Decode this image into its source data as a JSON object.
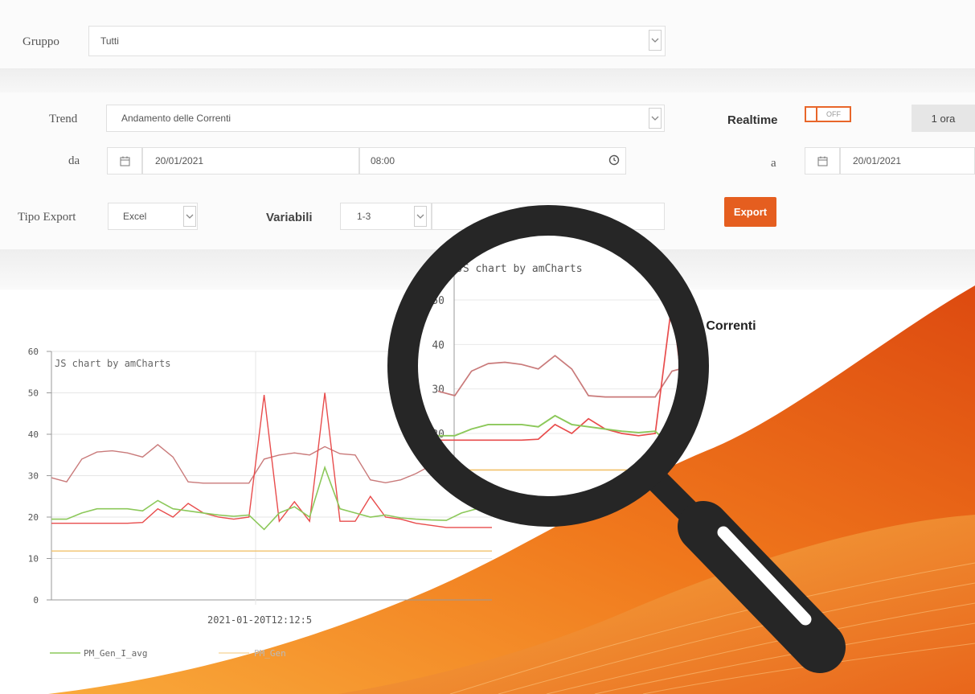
{
  "form": {
    "gruppo_label": "Gruppo",
    "gruppo_value": "Tutti",
    "trend_label": "Trend",
    "trend_value": "Andamento delle Correnti",
    "realtime_label": "Realtime",
    "toggle_text": "OFF",
    "range_label": "1 ora",
    "da_label": "da",
    "da_date": "20/01/2021",
    "da_time": "08:00",
    "a_label": "a",
    "a_date": "20/01/2021",
    "tipo_export_label": "Tipo Export",
    "tipo_export_value": "Excel",
    "variabili_label": "Variabili",
    "variabili_value": "1-3",
    "export_button": "Export"
  },
  "chart_title_partial": "e Correnti",
  "colors": {
    "accent": "#e55e1f",
    "red": "#e84c4c",
    "dark_red": "#c97a7a",
    "green": "#8cc85a",
    "yellow": "#f2c26b",
    "lens": "#262626"
  },
  "icons": [
    "chevron-down-icon",
    "calendar-icon",
    "clock-icon",
    "magnifier-icon"
  ],
  "chart_data": {
    "type": "line",
    "credit": "JS chart by amCharts",
    "ylim": [
      0,
      60
    ],
    "yticks": [
      0,
      10,
      20,
      30,
      40,
      50,
      60
    ],
    "x_label": "2021-01-20T12:12:5",
    "legend": [
      "PM_Gen_I_avg",
      "PM_Gen"
    ],
    "series": [
      {
        "name": "PM_Gen_I_avg",
        "values": [
          29.5,
          28.5,
          34,
          35.7,
          36,
          35.5,
          34.5,
          37.5,
          34.5,
          28.5,
          28.2,
          28.2,
          28.2,
          28.2,
          34,
          35,
          35.5,
          35,
          37,
          35.3,
          35,
          29,
          28.3,
          29,
          30.5,
          32.5,
          28.5,
          34,
          35.5,
          38
        ]
      },
      {
        "values": [
          18.5,
          18.5,
          18.5,
          18.5,
          18.5,
          18.5,
          18.7,
          22,
          20,
          23.3,
          21,
          20,
          19.5,
          20,
          49.5,
          19,
          23.7,
          19,
          50,
          19,
          19,
          25,
          20,
          19.5,
          18.5,
          18,
          17.5,
          17.5,
          17.5,
          17.5
        ]
      },
      {
        "values": [
          19.5,
          19.5,
          21,
          22,
          22,
          22,
          21.5,
          24,
          22,
          21.5,
          21,
          20.5,
          20.2,
          20.5,
          17,
          21,
          22.5,
          20,
          32,
          22,
          21,
          20,
          20.5,
          19.8,
          19.5,
          19.3,
          19.2,
          21,
          22,
          22.5
        ]
      },
      {
        "values": [
          11.8,
          11.8,
          11.8,
          11.8,
          11.8,
          11.8,
          11.8,
          11.8,
          11.8,
          11.8,
          11.8,
          11.8,
          11.8,
          11.8,
          11.8,
          11.8,
          11.8,
          11.8,
          11.8,
          11.8,
          11.8,
          11.8,
          11.8,
          11.8,
          11.8,
          11.8,
          11.8,
          11.8,
          11.8,
          11.8
        ]
      }
    ]
  }
}
